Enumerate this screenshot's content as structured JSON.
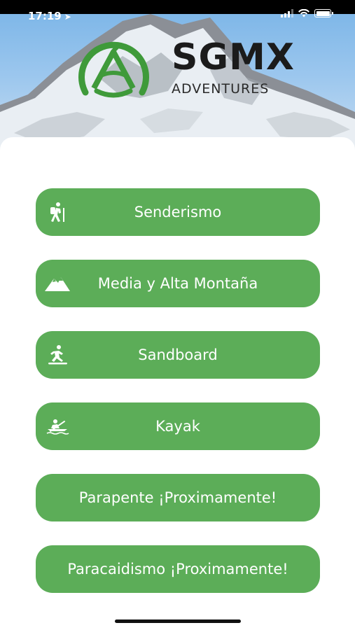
{
  "status_bar": {
    "time": "17:19"
  },
  "brand": {
    "name": "SGMX",
    "tagline": "ADVENTURES"
  },
  "menu": [
    {
      "label": "Senderismo",
      "icon": "hiker-icon"
    },
    {
      "label": "Media y Alta Montaña",
      "icon": "mountain-icon"
    },
    {
      "label": "Sandboard",
      "icon": "sandboard-icon"
    },
    {
      "label": "Kayak",
      "icon": "kayak-icon"
    },
    {
      "label": "Parapente ¡Proximamente!",
      "icon": ""
    },
    {
      "label": "Paracaidismo ¡Proximamente!",
      "icon": ""
    }
  ],
  "colors": {
    "accent": "#5cad58",
    "logo_green": "#3f9a3a"
  }
}
